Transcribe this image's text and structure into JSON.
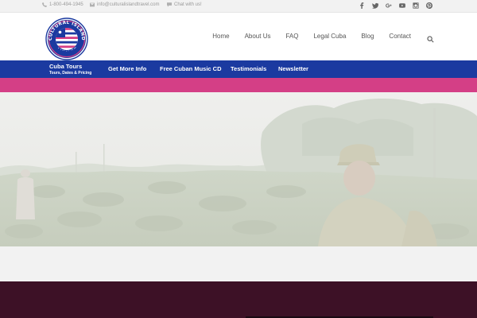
{
  "topbar": {
    "phone": "1-800-494-1945",
    "email": "info@culturalislandtravel.com",
    "chat": "Chat with us!",
    "socials": [
      "facebook-icon",
      "twitter-icon",
      "google-plus-icon",
      "youtube-icon",
      "instagram-icon",
      "pinterest-icon"
    ]
  },
  "logo": {
    "top_text": "CULTURAL ISLAND",
    "bottom_text": "TRAVEL"
  },
  "nav": {
    "items": [
      "Home",
      "About Us",
      "FAQ",
      "Legal Cuba",
      "Blog",
      "Contact"
    ]
  },
  "subnav": {
    "tours_label": "Cuba Tours",
    "tours_sub": "Tours, Dates & Pricing",
    "items": [
      "Get More Info",
      "Free Cuban Music CD",
      "Testimonials",
      "Newsletter"
    ]
  },
  "colors": {
    "blue": "#1b3aa0",
    "pink": "#d43f86",
    "maroon": "#3d1126"
  }
}
